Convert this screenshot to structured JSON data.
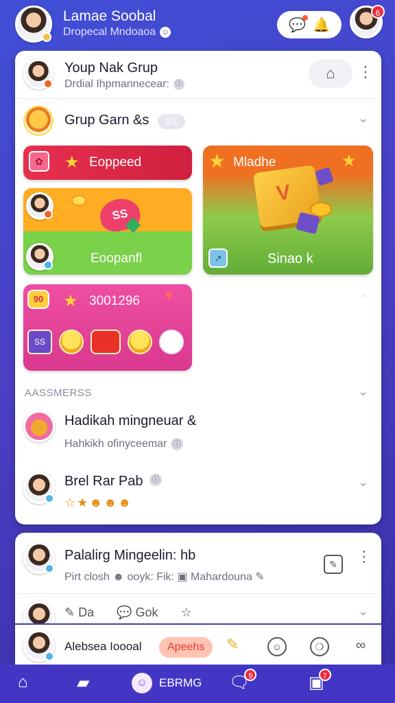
{
  "header": {
    "title": "Lamae Soobal",
    "subtitle": "Dropecal Mndoaoa",
    "subtitle_icon": "smile-icon",
    "friend_badge": "6"
  },
  "group": {
    "name": "Youp Nak Grup",
    "description": "Drdial Ihpmannecear:"
  },
  "games": {
    "title": "Grup Garn &s",
    "count": "1/1",
    "tiles": [
      {
        "label": "Eoppeed",
        "color": "#e02a47"
      },
      {
        "label": "Mladhe",
        "color": "#f07022"
      },
      {
        "label": "Eoopanfl",
        "color": "#ffad22"
      },
      {
        "label": "Sinao k",
        "color": "#62ad38"
      },
      {
        "label": "3001296",
        "color": "#e43f96"
      }
    ],
    "tile_badges": {
      "heart": "SS",
      "ribbon": "90",
      "item": "SS"
    }
  },
  "section_label": "AASSMERSS",
  "activities": [
    {
      "title": "Hadikah mingneuar &",
      "subtitle": "Hahkikh ofinyceemar"
    },
    {
      "title": "Brel Rar Pab",
      "emojis": "☆★☻☻☻"
    }
  ],
  "post": {
    "title": "Palalirg Mingeelin: hb",
    "subtitle": "Pirt closh ☻ ooyk: Fik: ▣ Mahardouna ✎",
    "actions": [
      "Da",
      "Gok",
      "☆"
    ]
  },
  "composer": {
    "name": "Alebsea Ioooal",
    "tag": "Apeehs"
  },
  "nav": {
    "center_label": "EBRMG",
    "messages_badge": "9",
    "alerts_badge": "7"
  }
}
